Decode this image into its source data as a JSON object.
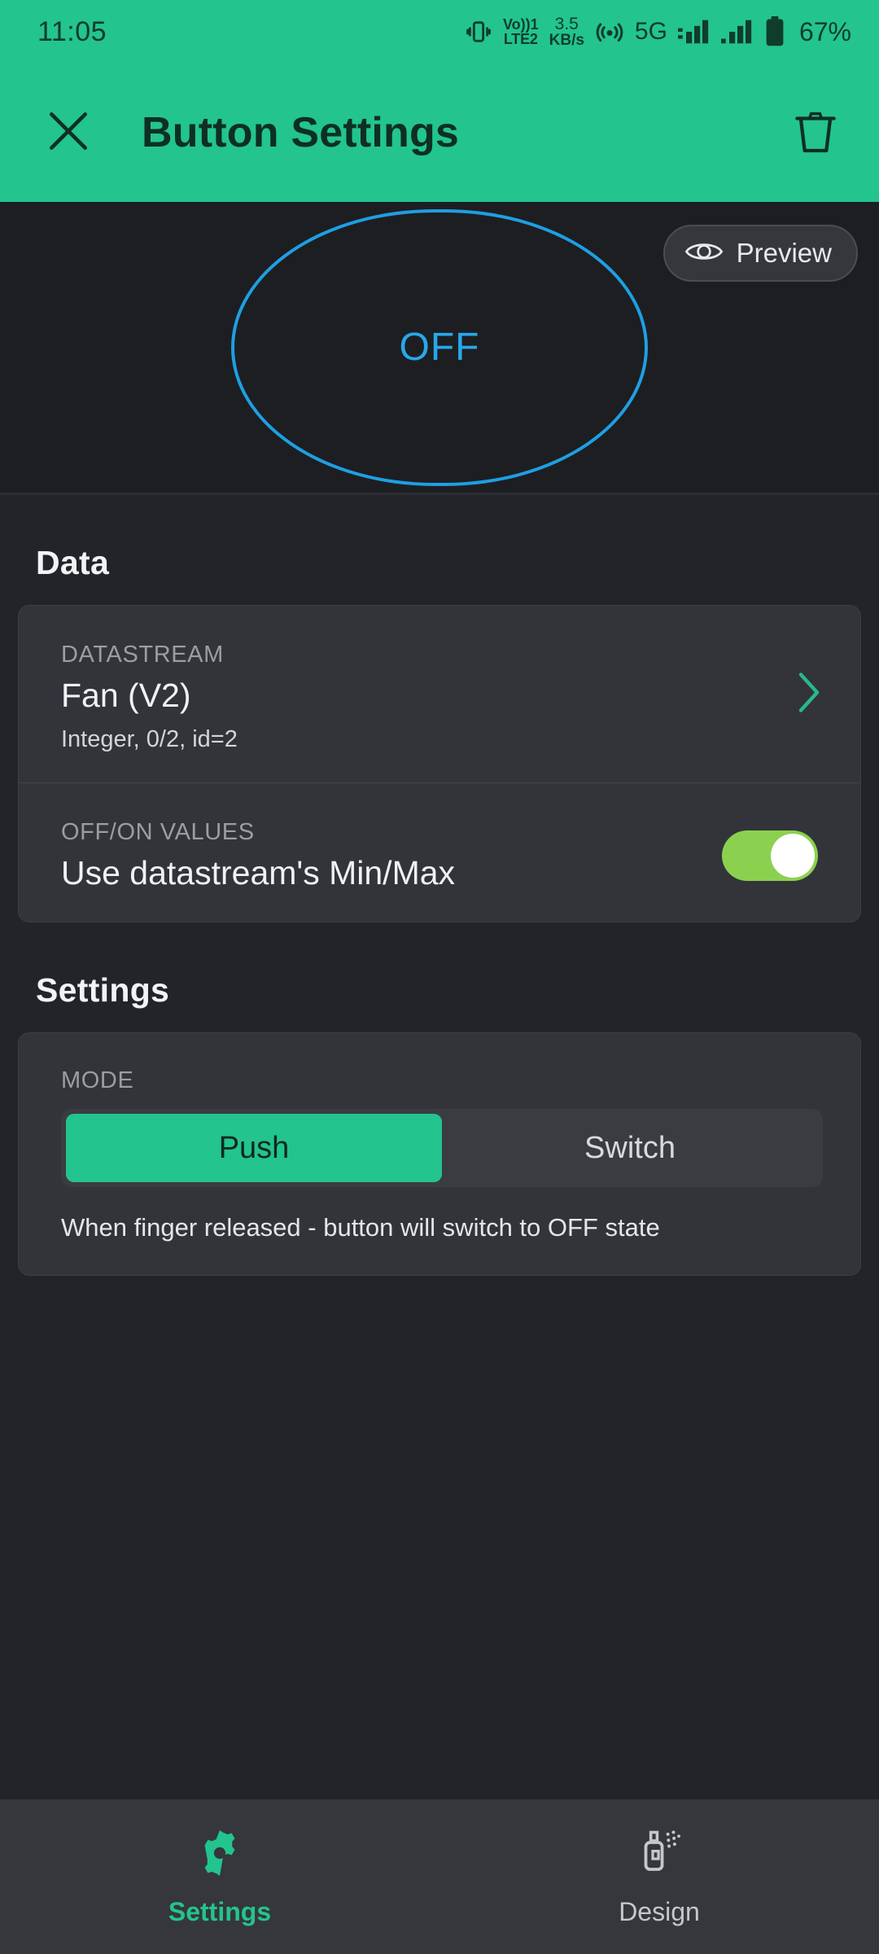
{
  "status_bar": {
    "time": "11:05",
    "vibrate_icon": "vibrate-icon",
    "volte_line1": "Vo))1",
    "volte_line2": "LTE2",
    "network_speed_value": "3.5",
    "network_speed_unit": "KB/s",
    "hotspot_icon": "hotspot-icon",
    "network_type": "5G",
    "signal_icon_1": "signal-bars-icon",
    "signal_icon_2": "signal-bars-icon",
    "battery_icon": "battery-icon",
    "battery_percent": "67%"
  },
  "appbar": {
    "close_icon": "close-icon",
    "title": "Button Settings",
    "delete_icon": "trash-icon"
  },
  "preview_stage": {
    "button_label": "OFF",
    "preview_pill_label": "Preview",
    "preview_pill_icon": "eye-icon",
    "button_outline_color": "#1E9FE3",
    "button_text_color": "#27A8EA"
  },
  "data_section": {
    "heading": "Data",
    "datastream": {
      "overline": "DATASTREAM",
      "value": "Fan (V2)",
      "sub": "Integer, 0/2, id=2",
      "chevron_icon": "chevron-right-icon"
    },
    "offon_values": {
      "overline": "OFF/ON VALUES",
      "value": "Use datastream's Min/Max",
      "toggle_state": "on",
      "toggle_color": "#8BD14F"
    }
  },
  "settings_section": {
    "heading": "Settings",
    "mode": {
      "overline": "MODE",
      "options": [
        {
          "label": "Push",
          "selected": true
        },
        {
          "label": "Switch",
          "selected": false
        }
      ],
      "help_text": "When finger released - button will switch to OFF state"
    }
  },
  "bottom_nav": {
    "items": [
      {
        "label": "Settings",
        "icon": "gear-icon",
        "active": true
      },
      {
        "label": "Design",
        "icon": "spray-can-icon",
        "active": false
      }
    ],
    "accent_color": "#23C48E"
  }
}
